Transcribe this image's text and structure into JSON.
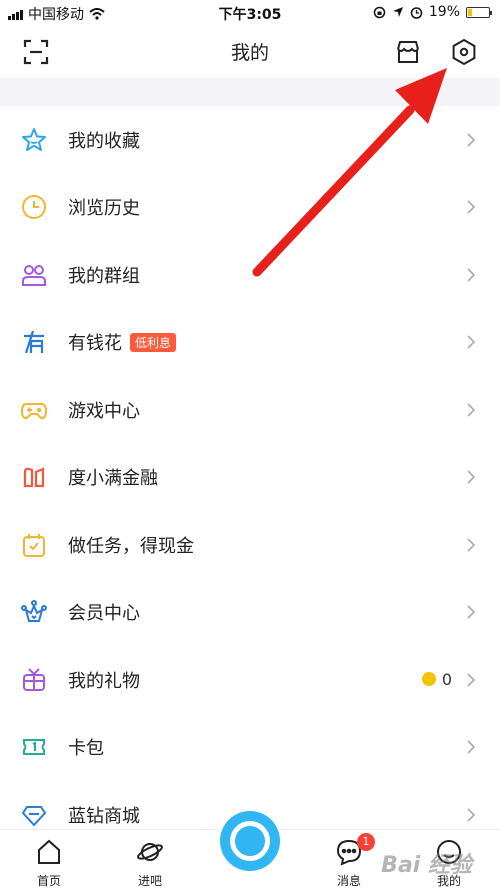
{
  "status_bar": {
    "carrier": "中国移动",
    "time": "下午3:05",
    "battery": "19%",
    "battery_level": 0.19
  },
  "header": {
    "title": "我的"
  },
  "menu": [
    {
      "label": "我的收藏",
      "icon": "star-icon"
    },
    {
      "label": "浏览历史",
      "icon": "clock-icon"
    },
    {
      "label": "我的群组",
      "icon": "group-icon"
    },
    {
      "label": "有钱花",
      "icon": "youqianhua-icon",
      "badge": "低利息"
    },
    {
      "label": "游戏中心",
      "icon": "gamepad-icon"
    },
    {
      "label": "度小满金融",
      "icon": "finance-icon"
    },
    {
      "label": "做任务，得现金",
      "icon": "calendar-task-icon"
    },
    {
      "label": "会员中心",
      "icon": "crown-icon"
    },
    {
      "label": "我的礼物",
      "icon": "gift-icon",
      "count": "0"
    },
    {
      "label": "卡包",
      "icon": "card-icon"
    },
    {
      "label": "蓝钻商城",
      "icon": "diamond-icon"
    }
  ],
  "tabs": {
    "home": "首页",
    "jinba": "进吧",
    "messages": "消息",
    "messages_badge": "1",
    "mine": "我的"
  },
  "colors": {
    "accent": "#2fb6f3",
    "badge": "#ff5a3a",
    "arrow": "#e8201c"
  },
  "watermark": "Bai 经验"
}
